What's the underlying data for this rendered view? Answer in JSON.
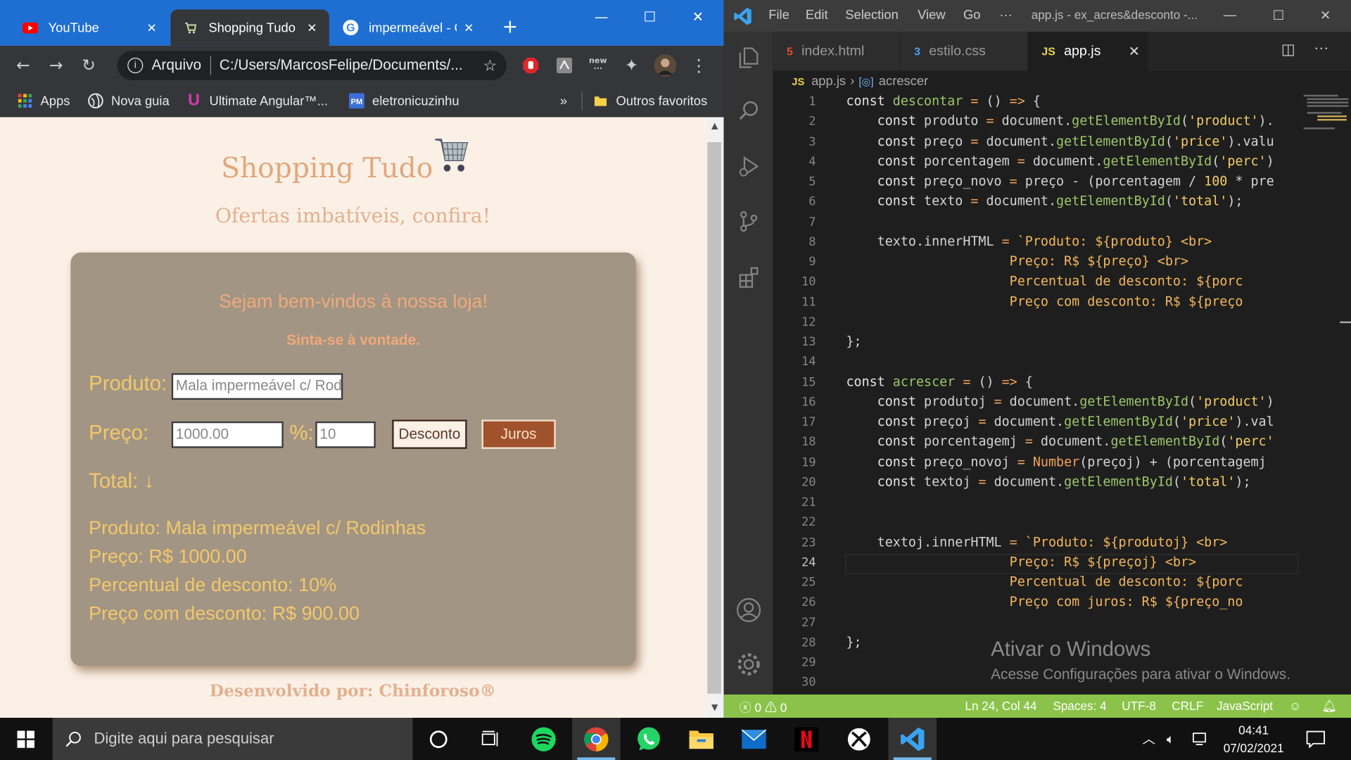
{
  "chrome": {
    "tabs": [
      {
        "label": "YouTube",
        "icon": "youtube-icon"
      },
      {
        "label": "Shopping Tudo",
        "icon": "cart-favicon"
      },
      {
        "label": "impermeável - C",
        "icon": "google-icon"
      }
    ],
    "address": {
      "security": "Arquivo",
      "url": "C:/Users/MarcosFelipe/Documents/..."
    },
    "bookmarks": [
      "Apps",
      "Nova guia",
      "Ultimate Angular™...",
      "eletronicuzinhu"
    ],
    "bookmarks_overflow": "»",
    "other_bookmarks": "Outros favoritos"
  },
  "page": {
    "title": "Shopping Tudo",
    "subtitle": "Ofertas imbatíveis, confira!",
    "welcome": "Sejam bem-vindos à nossa loja!",
    "sinta": "Sinta-se à vontade.",
    "product_label": "Produto:",
    "product_value": "Mala impermeável c/ Rodinhas",
    "price_label": "Preço:",
    "price_value": "1000.00",
    "percent_label": "%:",
    "percent_value": "10",
    "btn_desconto": "Desconto",
    "btn_juros": "Juros",
    "total_label": "Total: ↓",
    "result": [
      "Produto: Mala impermeável c/ Rodinhas",
      "Preço: R$ 1000.00",
      "Percentual de desconto: 10%",
      "Preço com desconto: R$ 900.00"
    ],
    "footer": "Desenvolvido por: Chinforoso®"
  },
  "vscode": {
    "menu": [
      "File",
      "Edit",
      "Selection",
      "View",
      "Go",
      "···"
    ],
    "title": "app.js - ex_acres&desconto -...",
    "tabs": [
      {
        "label": "index.html",
        "icon_text": "5"
      },
      {
        "label": "estilo.css",
        "icon_text": "3"
      },
      {
        "label": "app.js",
        "icon_text": "JS"
      }
    ],
    "breadcrumb": {
      "file": "app.js",
      "symbol": "acrescer"
    },
    "current_line": 24,
    "code": [
      "const descontar = () => {",
      "    const produto = document.getElementById('product').",
      "    const preço = document.getElementById('price').valu",
      "    const porcentagem = document.getElementById('perc')",
      "    const preço_novo = preço - (porcentagem / 100 * pre",
      "    const texto = document.getElementById('total');",
      "",
      "    texto.innerHTML = `Produto: ${produto} <br>",
      "                     Preço: R$ ${preço} <br>",
      "                     Percentual de desconto: ${porc",
      "                     Preço com desconto: R$ ${preço",
      "",
      "};",
      "",
      "const acrescer = () => {",
      "    const produtoj = document.getElementById('product')",
      "    const preçoj = document.getElementById('price').val",
      "    const porcentagemj = document.getElementById('perc'",
      "    const preço_novoj = Number(preçoj) + (porcentagemj",
      "    const textoj = document.getElementById('total');",
      "",
      "",
      "    textoj.innerHTML = `Produto: ${produtoj} <br>",
      "                     Preço: R$ ${preçoj} <br>",
      "                     Percentual de desconto: ${porc",
      "                     Preço com juros: R$ ${preço_no",
      "",
      "};",
      "",
      ""
    ],
    "activate_title": "Ativar o Windows",
    "activate_sub": "Acesse Configurações para ativar o Windows.",
    "status": {
      "errors": "0",
      "warnings": "0",
      "position": "Ln 24, Col 44",
      "spaces": "Spaces: 4",
      "encoding": "UTF-8",
      "eol": "CRLF",
      "language": "JavaScript"
    }
  },
  "taskbar": {
    "search_placeholder": "Digite aqui para pesquisar",
    "apps": [
      "cortana-icon",
      "task-view-icon",
      "spotify-icon",
      "chrome-icon",
      "whatsapp-icon",
      "file-explorer-icon",
      "mail-icon",
      "netflix-icon",
      "xbox-icon",
      "vscode-icon"
    ],
    "time": "04:41",
    "date": "07/02/2021"
  },
  "colors": {
    "chrome_blue": "#1f6fd3",
    "page_bg": "#fbf0e6",
    "card_bg": "#a29583",
    "accent_orange": "#e0a87c",
    "text_yellow": "#f3c86b",
    "juros_btn": "#a0522d",
    "vscode_status": "#8bc34a"
  }
}
